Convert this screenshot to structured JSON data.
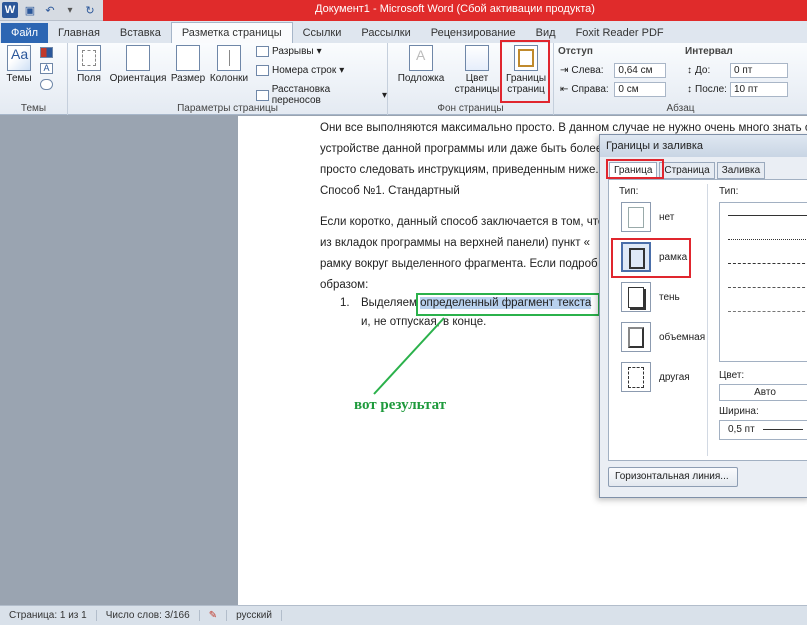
{
  "window": {
    "title": "Документ1 - Microsoft Word (Сбой активации продукта)"
  },
  "tabs": [
    "Файл",
    "Главная",
    "Вставка",
    "Разметка страницы",
    "Ссылки",
    "Рассылки",
    "Рецензирование",
    "Вид",
    "Foxit Reader PDF"
  ],
  "ribbon": {
    "themes": {
      "label": "Темы",
      "group": "Темы"
    },
    "page_setup": {
      "group": "Параметры страницы",
      "fields": "Поля",
      "orientation": "Ориентация",
      "size": "Размер",
      "columns": "Колонки",
      "breaks": "Разрывы",
      "line_numbers": "Номера строк",
      "hyphenation": "Расстановка переносов"
    },
    "background": {
      "group": "Фон страницы",
      "watermark": "Подложка",
      "page_color_1": "Цвет",
      "page_color_2": "страницы",
      "borders_1": "Границы",
      "borders_2": "страниц"
    },
    "paragraph": {
      "group": "Абзац",
      "indent": "Отступ",
      "left": "Слева:",
      "left_val": "0,64 см",
      "right": "Справа:",
      "right_val": "0 см",
      "spacing": "Интервал",
      "before": "До:",
      "before_val": "0 пт",
      "after": "После:",
      "after_val": "10 пт"
    }
  },
  "document": {
    "line1": "Они все выполняются максимально просто. В данном случае не нужно очень много знать об",
    "line2": "устройстве данной программы или даже быть более",
    "line3": "просто следовать инструкциям, приведенным ниже.",
    "heading": "Способ №1. Стандартный",
    "p1": "Если коротко, данный способ заключается в том, что",
    "p2": "из вкладок программы на верхней панели) пункт «",
    "p3": "рамку вокруг выделенного фрагмента. Если подроб",
    "p4": "образом:",
    "list_num": "1.",
    "list_pre": "Выделяем",
    "list_sel": "определенный фрагмент текста",
    "list_line2": "и, не отпуская, в конце.",
    "annotation": "вот результат"
  },
  "dialog": {
    "title": "Границы и заливка",
    "tabs": [
      "Граница",
      "Страница",
      "Заливка"
    ],
    "type_label": "Тип:",
    "options": [
      "нет",
      "рамка",
      "тень",
      "объемная",
      "другая"
    ],
    "style_label": "Тип:",
    "color_label": "Цвет:",
    "color_value": "Авто",
    "width_label": "Ширина:",
    "width_value": "0,5 пт",
    "hline_button": "Горизонтальная линия..."
  },
  "status": {
    "page": "Страница: 1 из 1",
    "words": "Число слов: 3/166",
    "lang": "русский"
  }
}
